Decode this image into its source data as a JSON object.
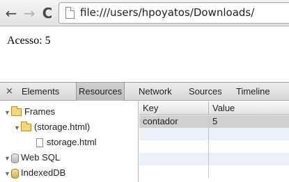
{
  "browser": {
    "back_icon": "←",
    "forward_icon": "→",
    "reload_icon": "C",
    "url": "file:///users/hpoyatos/Downloads/"
  },
  "page": {
    "text": "Acesso: 5"
  },
  "devtools": {
    "close_icon": "×",
    "tabs": [
      {
        "label": "Elements"
      },
      {
        "label": "Resources"
      },
      {
        "label": "Network"
      },
      {
        "label": "Sources"
      },
      {
        "label": "Timeline"
      }
    ],
    "active_tab": "Resources",
    "sidebar": {
      "frames": "Frames",
      "frame_child": "(storage.html)",
      "file": "storage.html",
      "websql": "Web SQL",
      "indexeddb": "IndexedDB",
      "expanded_glyph": "▼"
    },
    "table": {
      "headers": {
        "key": "Key",
        "value": "Value"
      },
      "rows": [
        {
          "key": "contador",
          "value": "5"
        }
      ]
    }
  }
}
